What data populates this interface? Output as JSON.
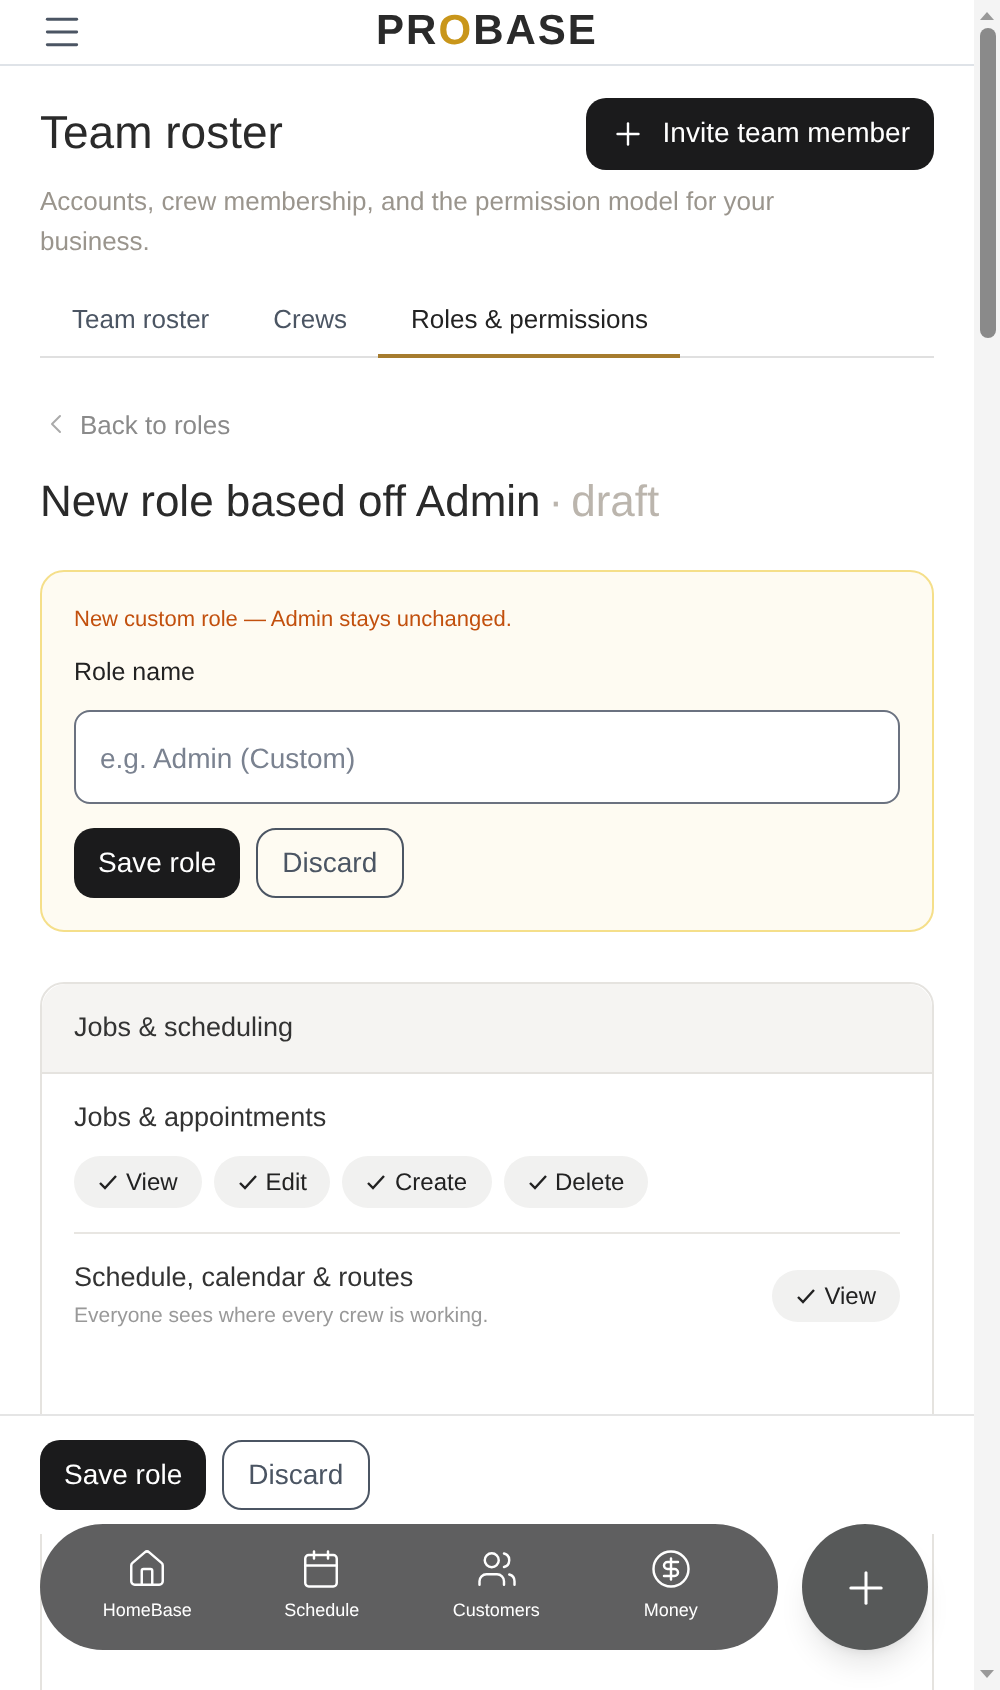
{
  "header": {
    "logo": "PROBASE"
  },
  "page": {
    "title": "Team roster",
    "invite_button": "Invite team member",
    "subtitle": "Accounts, crew membership, and the permission model for your business."
  },
  "tabs": [
    {
      "label": "Team roster",
      "selected": false
    },
    {
      "label": "Crews",
      "selected": false
    },
    {
      "label": "Roles & permissions",
      "selected": true
    }
  ],
  "back_link": "Back to roles",
  "role_title": "New role based off Admin",
  "role_separator": "·",
  "role_status": "draft",
  "notice": {
    "message": "New custom role — Admin stays unchanged.",
    "label": "Role name",
    "placeholder": "e.g. Admin (Custom)",
    "save": "Save role",
    "discard": "Discard"
  },
  "section": {
    "title": "Jobs & scheduling",
    "rows": [
      {
        "kind": "chips",
        "name": "Jobs & appointments",
        "chips": [
          {
            "label": "View",
            "checked": true
          },
          {
            "label": "Edit",
            "checked": true
          },
          {
            "label": "Create",
            "checked": true
          },
          {
            "label": "Delete",
            "checked": true
          }
        ]
      },
      {
        "kind": "side",
        "name": "Schedule, calendar & routes",
        "description": "Everyone sees where every crew is working.",
        "chips": [
          {
            "label": "View",
            "checked": true
          }
        ]
      }
    ]
  },
  "action_bar": {
    "save": "Save role",
    "discard": "Discard"
  },
  "nav": [
    {
      "label": "HomeBase"
    },
    {
      "label": "Schedule"
    },
    {
      "label": "Customers"
    },
    {
      "label": "Money"
    }
  ]
}
